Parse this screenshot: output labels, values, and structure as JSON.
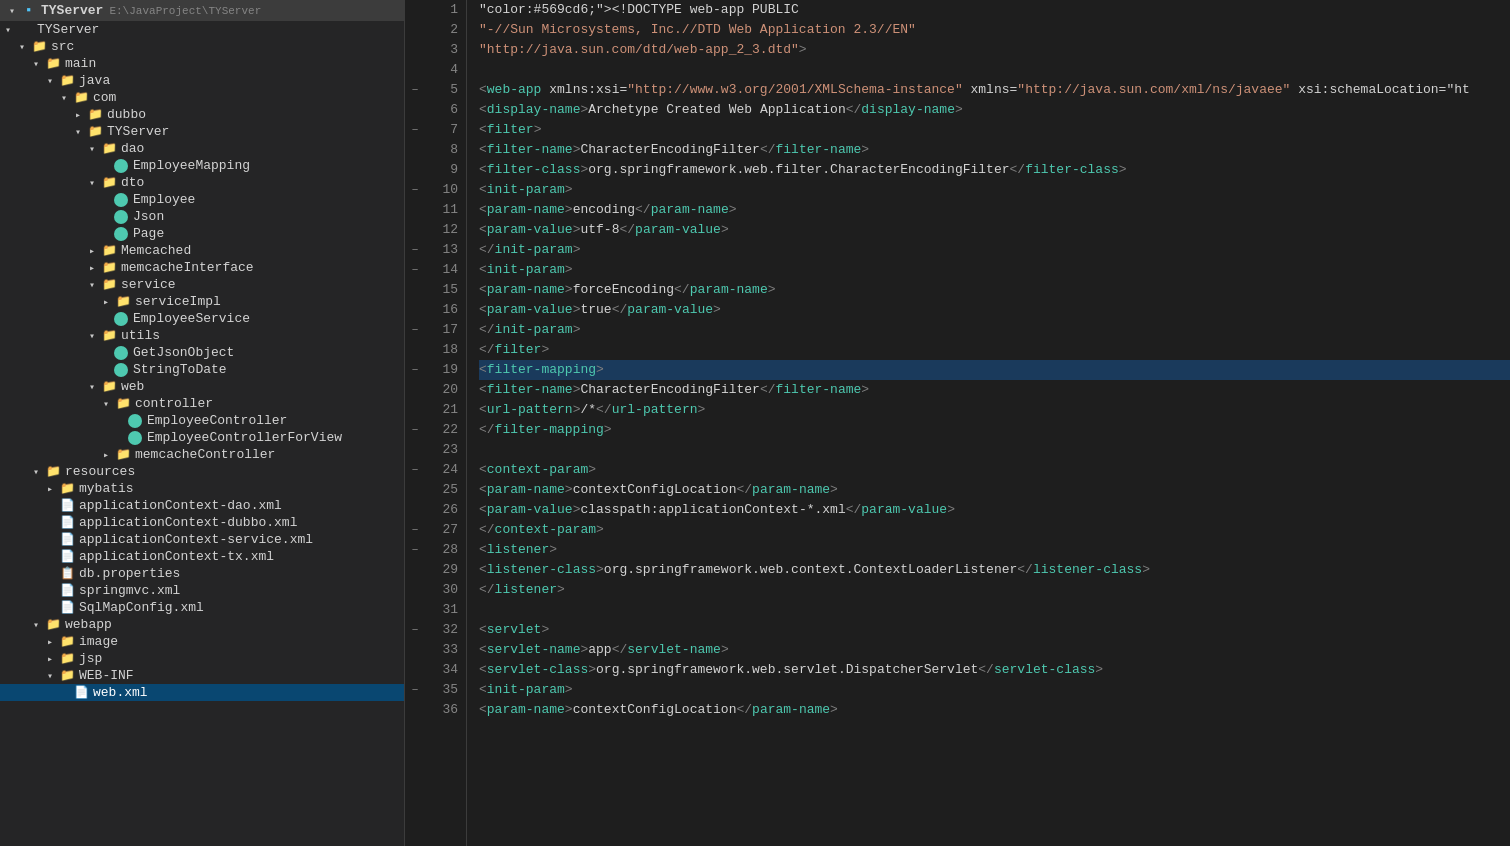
{
  "sidebar": {
    "root": {
      "label": "TYServer",
      "path": "E:\\JavaProject\\TYServer"
    },
    "tree": [
      {
        "id": "tyserver-root",
        "label": "TYServer",
        "type": "project",
        "level": 0,
        "expanded": true,
        "icon": "project"
      },
      {
        "id": "src",
        "label": "src",
        "type": "folder",
        "level": 1,
        "expanded": true,
        "icon": "folder"
      },
      {
        "id": "main",
        "label": "main",
        "type": "folder",
        "level": 2,
        "expanded": true,
        "icon": "folder"
      },
      {
        "id": "java",
        "label": "java",
        "type": "folder",
        "level": 3,
        "expanded": true,
        "icon": "folder"
      },
      {
        "id": "com",
        "label": "com",
        "type": "folder",
        "level": 4,
        "expanded": true,
        "icon": "folder"
      },
      {
        "id": "dubbo",
        "label": "dubbo",
        "type": "folder",
        "level": 5,
        "expanded": false,
        "icon": "folder"
      },
      {
        "id": "TYServer",
        "label": "TYServer",
        "type": "folder",
        "level": 5,
        "expanded": true,
        "icon": "folder"
      },
      {
        "id": "dao",
        "label": "dao",
        "type": "folder",
        "level": 6,
        "expanded": true,
        "icon": "folder"
      },
      {
        "id": "EmployeeMapping",
        "label": "EmployeeMapping",
        "type": "java-green",
        "level": 7,
        "expanded": false,
        "icon": "green-circle"
      },
      {
        "id": "dto",
        "label": "dto",
        "type": "folder",
        "level": 6,
        "expanded": true,
        "icon": "folder"
      },
      {
        "id": "Employee",
        "label": "Employee",
        "type": "java-green",
        "level": 7,
        "expanded": false,
        "icon": "green-circle"
      },
      {
        "id": "Json",
        "label": "Json",
        "type": "java-green",
        "level": 7,
        "expanded": false,
        "icon": "green-circle"
      },
      {
        "id": "Page",
        "label": "Page",
        "type": "java-green",
        "level": 7,
        "expanded": false,
        "icon": "green-circle"
      },
      {
        "id": "Memcached",
        "label": "Memcached",
        "type": "folder",
        "level": 6,
        "expanded": false,
        "icon": "folder"
      },
      {
        "id": "memcacheInterface",
        "label": "memcacheInterface",
        "type": "folder",
        "level": 6,
        "expanded": false,
        "icon": "folder"
      },
      {
        "id": "service",
        "label": "service",
        "type": "folder",
        "level": 6,
        "expanded": true,
        "icon": "folder"
      },
      {
        "id": "serviceImpl",
        "label": "serviceImpl",
        "type": "folder",
        "level": 7,
        "expanded": false,
        "icon": "folder"
      },
      {
        "id": "EmployeeService",
        "label": "EmployeeService",
        "type": "java-green",
        "level": 7,
        "expanded": false,
        "icon": "green-circle"
      },
      {
        "id": "utils",
        "label": "utils",
        "type": "folder",
        "level": 6,
        "expanded": true,
        "icon": "folder"
      },
      {
        "id": "GetJsonObject",
        "label": "GetJsonObject",
        "type": "java-green",
        "level": 7,
        "expanded": false,
        "icon": "green-circle"
      },
      {
        "id": "StringToDate",
        "label": "StringToDate",
        "type": "java-green",
        "level": 7,
        "expanded": false,
        "icon": "green-circle"
      },
      {
        "id": "web",
        "label": "web",
        "type": "folder",
        "level": 6,
        "expanded": true,
        "icon": "folder"
      },
      {
        "id": "controller",
        "label": "controller",
        "type": "folder",
        "level": 7,
        "expanded": true,
        "icon": "folder"
      },
      {
        "id": "EmployeeController",
        "label": "EmployeeController",
        "type": "java-green",
        "level": 8,
        "expanded": false,
        "icon": "green-circle"
      },
      {
        "id": "EmployeeControllerForView",
        "label": "EmployeeControllerForView",
        "type": "java-green",
        "level": 8,
        "expanded": false,
        "icon": "green-circle"
      },
      {
        "id": "memcacheController",
        "label": "memcacheController",
        "type": "folder",
        "level": 7,
        "expanded": false,
        "icon": "folder"
      },
      {
        "id": "resources",
        "label": "resources",
        "type": "folder",
        "level": 2,
        "expanded": true,
        "icon": "folder"
      },
      {
        "id": "mybatis",
        "label": "mybatis",
        "type": "folder",
        "level": 3,
        "expanded": false,
        "icon": "folder"
      },
      {
        "id": "applicationContext-dao.xml",
        "label": "applicationContext-dao.xml",
        "type": "xml",
        "level": 3,
        "expanded": false,
        "icon": "xml"
      },
      {
        "id": "applicationContext-dubbo.xml",
        "label": "applicationContext-dubbo.xml",
        "type": "xml",
        "level": 3,
        "expanded": false,
        "icon": "xml"
      },
      {
        "id": "applicationContext-service.xml",
        "label": "applicationContext-service.xml",
        "type": "xml",
        "level": 3,
        "expanded": false,
        "icon": "xml"
      },
      {
        "id": "applicationContext-tx.xml",
        "label": "applicationContext-tx.xml",
        "type": "xml",
        "level": 3,
        "expanded": false,
        "icon": "xml"
      },
      {
        "id": "db.properties",
        "label": "db.properties",
        "type": "properties",
        "level": 3,
        "expanded": false,
        "icon": "properties"
      },
      {
        "id": "springmvc.xml",
        "label": "springmvc.xml",
        "type": "xml",
        "level": 3,
        "expanded": false,
        "icon": "xml"
      },
      {
        "id": "SqlMapConfig.xml",
        "label": "SqlMapConfig.xml",
        "type": "xml",
        "level": 3,
        "expanded": false,
        "icon": "xml"
      },
      {
        "id": "webapp",
        "label": "webapp",
        "type": "folder",
        "level": 2,
        "expanded": true,
        "icon": "folder"
      },
      {
        "id": "image",
        "label": "image",
        "type": "folder",
        "level": 3,
        "expanded": false,
        "icon": "folder"
      },
      {
        "id": "jsp",
        "label": "jsp",
        "type": "folder",
        "level": 3,
        "expanded": false,
        "icon": "folder"
      },
      {
        "id": "WEB-INF",
        "label": "WEB-INF",
        "type": "folder",
        "level": 3,
        "expanded": true,
        "icon": "folder"
      },
      {
        "id": "web.xml",
        "label": "web.xml",
        "type": "xml",
        "level": 4,
        "expanded": false,
        "icon": "xml",
        "selected": true
      }
    ]
  },
  "editor": {
    "filename": "web.xml",
    "lines": [
      {
        "num": 1,
        "content": "<!DOCTYPE web-app PUBLIC",
        "fold": false,
        "highlight": false
      },
      {
        "num": 2,
        "content": "    \"-//Sun Microsystems, Inc.//DTD Web Application 2.3//EN\"",
        "fold": false,
        "highlight": false
      },
      {
        "num": 3,
        "content": "    \"http://java.sun.com/dtd/web-app_2_3.dtd\" >",
        "fold": false,
        "highlight": false
      },
      {
        "num": 4,
        "content": "",
        "fold": false,
        "highlight": false
      },
      {
        "num": 5,
        "content": "<web-app xmlns:xsi=\"http://www.w3.org/2001/XMLSchema-instance\" xmlns=\"http://java.sun.com/xml/ns/javaee\" xsi:schemaLocation=\"ht",
        "fold": true,
        "highlight": false
      },
      {
        "num": 6,
        "content": "    <display-name>Archetype Created Web Application</display-name>",
        "fold": false,
        "highlight": false
      },
      {
        "num": 7,
        "content": "    <filter>",
        "fold": true,
        "highlight": false
      },
      {
        "num": 8,
        "content": "        <filter-name>CharacterEncodingFilter</filter-name>",
        "fold": false,
        "highlight": false
      },
      {
        "num": 9,
        "content": "        <filter-class>org.springframework.web.filter.CharacterEncodingFilter</filter-class>",
        "fold": false,
        "highlight": false
      },
      {
        "num": 10,
        "content": "        <init-param>",
        "fold": true,
        "highlight": false
      },
      {
        "num": 11,
        "content": "            <param-name>encoding</param-name>",
        "fold": false,
        "highlight": false
      },
      {
        "num": 12,
        "content": "            <param-value>utf-8</param-value>",
        "fold": false,
        "highlight": false
      },
      {
        "num": 13,
        "content": "        </init-param>",
        "fold": true,
        "highlight": false
      },
      {
        "num": 14,
        "content": "        <init-param>",
        "fold": true,
        "highlight": false
      },
      {
        "num": 15,
        "content": "            <param-name>forceEncoding</param-name>",
        "fold": false,
        "highlight": false
      },
      {
        "num": 16,
        "content": "            <param-value>true</param-value>",
        "fold": false,
        "highlight": false
      },
      {
        "num": 17,
        "content": "        </init-param>",
        "fold": true,
        "highlight": false
      },
      {
        "num": 18,
        "content": "    </filter>",
        "fold": false,
        "highlight": false
      },
      {
        "num": 19,
        "content": "    <filter-mapping>",
        "fold": true,
        "highlight": true
      },
      {
        "num": 20,
        "content": "        <filter-name>CharacterEncodingFilter</filter-name>",
        "fold": false,
        "highlight": false
      },
      {
        "num": 21,
        "content": "        <url-pattern>/*</url-pattern>",
        "fold": false,
        "highlight": false
      },
      {
        "num": 22,
        "content": "    </filter-mapping>",
        "fold": true,
        "highlight": false
      },
      {
        "num": 23,
        "content": "",
        "fold": false,
        "highlight": false
      },
      {
        "num": 24,
        "content": "    <context-param>",
        "fold": true,
        "highlight": false
      },
      {
        "num": 25,
        "content": "        <param-name>contextConfigLocation</param-name>",
        "fold": false,
        "highlight": false
      },
      {
        "num": 26,
        "content": "        <param-value>classpath:applicationContext-*.xml</param-value>",
        "fold": false,
        "highlight": false
      },
      {
        "num": 27,
        "content": "    </context-param>",
        "fold": true,
        "highlight": false
      },
      {
        "num": 28,
        "content": "    <listener>",
        "fold": true,
        "highlight": false
      },
      {
        "num": 29,
        "content": "        <listener-class>org.springframework.web.context.ContextLoaderListener</listener-class>",
        "fold": false,
        "highlight": false
      },
      {
        "num": 30,
        "content": "    </listener>",
        "fold": false,
        "highlight": false
      },
      {
        "num": 31,
        "content": "",
        "fold": false,
        "highlight": false
      },
      {
        "num": 32,
        "content": "    <servlet>",
        "fold": true,
        "highlight": false
      },
      {
        "num": 33,
        "content": "        <servlet-name>app</servlet-name>",
        "fold": false,
        "highlight": false
      },
      {
        "num": 34,
        "content": "        <servlet-class>org.springframework.web.servlet.DispatcherServlet</servlet-class>",
        "fold": false,
        "highlight": false
      },
      {
        "num": 35,
        "content": "        <init-param>",
        "fold": true,
        "highlight": false
      },
      {
        "num": 36,
        "content": "            <param-name>contextConfigLocation</param-name>",
        "fold": false,
        "highlight": false
      }
    ]
  }
}
